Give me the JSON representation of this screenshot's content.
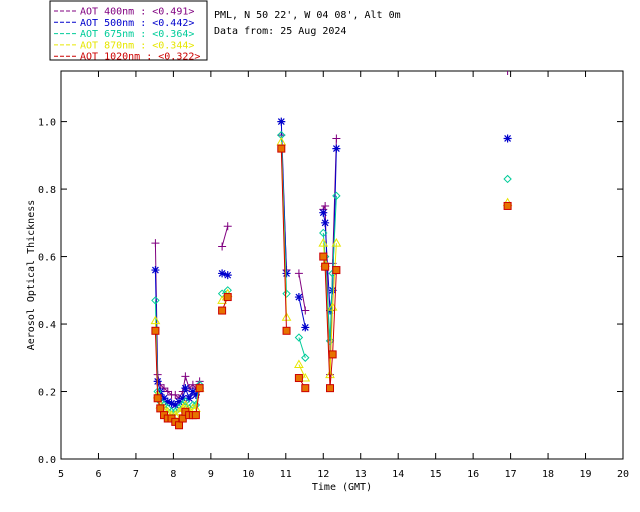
{
  "chart_data": {
    "type": "line",
    "title_lines": [
      "PML, N 50 22', W 04 08', Alt 0m",
      "Data from: 25 Aug 2024"
    ],
    "xlabel": "Time (GMT)",
    "ylabel": "Aerosol Optical Thickness",
    "xlim": [
      5,
      20
    ],
    "ylim": [
      0,
      1.15
    ],
    "xticks": [
      "5",
      "6",
      "7",
      "8",
      "9",
      "10",
      "11",
      "12",
      "13",
      "14",
      "15",
      "16",
      "17",
      "18",
      "19",
      "20"
    ],
    "yticks": [
      "0.0",
      "0.2",
      "0.4",
      "0.6",
      "0.8",
      "1.0"
    ],
    "grid": false,
    "legend_position": "top-left, outside plot",
    "series": [
      {
        "name": "AOT  400nm : <0.491>",
        "color": "#800080",
        "marker": "plus",
        "segments": [
          [
            [
              7.52,
              0.64
            ],
            [
              7.58,
              0.25
            ],
            [
              7.65,
              0.22
            ],
            [
              7.75,
              0.21
            ],
            [
              7.85,
              0.2
            ],
            [
              7.95,
              0.19
            ],
            [
              8.05,
              0.19
            ],
            [
              8.15,
              0.18
            ],
            [
              8.25,
              0.2
            ],
            [
              8.32,
              0.245
            ],
            [
              8.42,
              0.21
            ],
            [
              8.52,
              0.22
            ],
            [
              8.6,
              0.21
            ],
            [
              8.7,
              0.23
            ]
          ],
          [
            [
              9.3,
              0.63
            ],
            [
              9.45,
              0.69
            ]
          ],
          [
            [
              10.88,
              0.96
            ],
            [
              11.02,
              0.56
            ]
          ],
          [
            [
              11.35,
              0.55
            ],
            [
              11.52,
              0.44
            ]
          ],
          [
            [
              12.0,
              0.74
            ],
            [
              12.05,
              0.75
            ],
            [
              12.18,
              0.25
            ],
            [
              12.25,
              0.58
            ],
            [
              12.35,
              0.95
            ]
          ],
          [
            [
              16.92,
              1.16
            ]
          ]
        ]
      },
      {
        "name": "AOT  500nm : <0.442>",
        "color": "#0000cc",
        "marker": "star",
        "segments": [
          [
            [
              7.52,
              0.56
            ],
            [
              7.58,
              0.23
            ],
            [
              7.65,
              0.2
            ],
            [
              7.75,
              0.18
            ],
            [
              7.85,
              0.17
            ],
            [
              7.95,
              0.165
            ],
            [
              8.05,
              0.16
            ],
            [
              8.15,
              0.17
            ],
            [
              8.25,
              0.18
            ],
            [
              8.32,
              0.21
            ],
            [
              8.42,
              0.18
            ],
            [
              8.52,
              0.2
            ],
            [
              8.6,
              0.19
            ],
            [
              8.7,
              0.21
            ]
          ],
          [
            [
              9.3,
              0.55
            ],
            [
              9.45,
              0.545
            ]
          ],
          [
            [
              10.88,
              1.0
            ],
            [
              11.02,
              0.55
            ]
          ],
          [
            [
              11.35,
              0.48
            ],
            [
              11.52,
              0.39
            ]
          ],
          [
            [
              12.0,
              0.73
            ],
            [
              12.05,
              0.7
            ],
            [
              12.18,
              0.44
            ],
            [
              12.25,
              0.5
            ],
            [
              12.35,
              0.92
            ]
          ],
          [
            [
              16.92,
              0.95
            ]
          ]
        ]
      },
      {
        "name": "AOT  675nm : <0.364>",
        "color": "#00cc99",
        "marker": "diamond",
        "segments": [
          [
            [
              7.52,
              0.47
            ],
            [
              7.58,
              0.2
            ],
            [
              7.65,
              0.17
            ],
            [
              7.75,
              0.16
            ],
            [
              7.85,
              0.15
            ],
            [
              7.95,
              0.14
            ],
            [
              8.05,
              0.14
            ],
            [
              8.15,
              0.15
            ],
            [
              8.25,
              0.16
            ],
            [
              8.32,
              0.17
            ],
            [
              8.42,
              0.15
            ],
            [
              8.52,
              0.16
            ],
            [
              8.6,
              0.16
            ],
            [
              8.7,
              0.22
            ]
          ],
          [
            [
              9.3,
              0.49
            ],
            [
              9.45,
              0.5
            ]
          ],
          [
            [
              10.88,
              0.96
            ],
            [
              11.02,
              0.49
            ]
          ],
          [
            [
              11.35,
              0.36
            ],
            [
              11.52,
              0.3
            ]
          ],
          [
            [
              12.0,
              0.67
            ],
            [
              12.05,
              0.6
            ],
            [
              12.18,
              0.35
            ],
            [
              12.25,
              0.55
            ],
            [
              12.35,
              0.78
            ]
          ],
          [
            [
              16.92,
              0.83
            ]
          ]
        ]
      },
      {
        "name": "AOT  870nm : <0.344>",
        "color": "#e6e600",
        "marker": "triangle",
        "segments": [
          [
            [
              7.52,
              0.41
            ],
            [
              7.58,
              0.19
            ],
            [
              7.65,
              0.16
            ],
            [
              7.75,
              0.15
            ],
            [
              7.85,
              0.14
            ],
            [
              7.95,
              0.13
            ],
            [
              8.05,
              0.13
            ],
            [
              8.15,
              0.14
            ],
            [
              8.25,
              0.15
            ],
            [
              8.32,
              0.16
            ],
            [
              8.42,
              0.14
            ],
            [
              8.52,
              0.15
            ],
            [
              8.6,
              0.15
            ],
            [
              8.7,
              0.21
            ]
          ],
          [
            [
              9.3,
              0.47
            ],
            [
              9.45,
              0.49
            ]
          ],
          [
            [
              10.88,
              0.94
            ],
            [
              11.02,
              0.42
            ]
          ],
          [
            [
              11.35,
              0.28
            ],
            [
              11.52,
              0.24
            ]
          ],
          [
            [
              12.0,
              0.64
            ],
            [
              12.05,
              0.58
            ],
            [
              12.18,
              0.25
            ],
            [
              12.25,
              0.45
            ],
            [
              12.35,
              0.64
            ]
          ],
          [
            [
              16.92,
              0.76
            ]
          ]
        ]
      },
      {
        "name": "AOT 1020nm : <0.322>",
        "color": "#cc0000",
        "marker": "square",
        "boxcolor": "#e67300",
        "segments": [
          [
            [
              7.52,
              0.38
            ],
            [
              7.58,
              0.18
            ],
            [
              7.65,
              0.15
            ],
            [
              7.75,
              0.13
            ],
            [
              7.85,
              0.12
            ],
            [
              7.95,
              0.12
            ],
            [
              8.05,
              0.11
            ],
            [
              8.15,
              0.1
            ],
            [
              8.25,
              0.12
            ],
            [
              8.32,
              0.14
            ],
            [
              8.42,
              0.13
            ],
            [
              8.52,
              0.13
            ],
            [
              8.6,
              0.13
            ],
            [
              8.7,
              0.21
            ]
          ],
          [
            [
              9.3,
              0.44
            ],
            [
              9.45,
              0.48
            ]
          ],
          [
            [
              10.88,
              0.92
            ],
            [
              11.02,
              0.38
            ]
          ],
          [
            [
              11.35,
              0.24
            ],
            [
              11.52,
              0.21
            ]
          ],
          [
            [
              12.0,
              0.6
            ],
            [
              12.05,
              0.57
            ],
            [
              12.18,
              0.21
            ],
            [
              12.25,
              0.31
            ],
            [
              12.35,
              0.56
            ]
          ],
          [
            [
              16.92,
              0.75
            ]
          ]
        ]
      }
    ]
  }
}
